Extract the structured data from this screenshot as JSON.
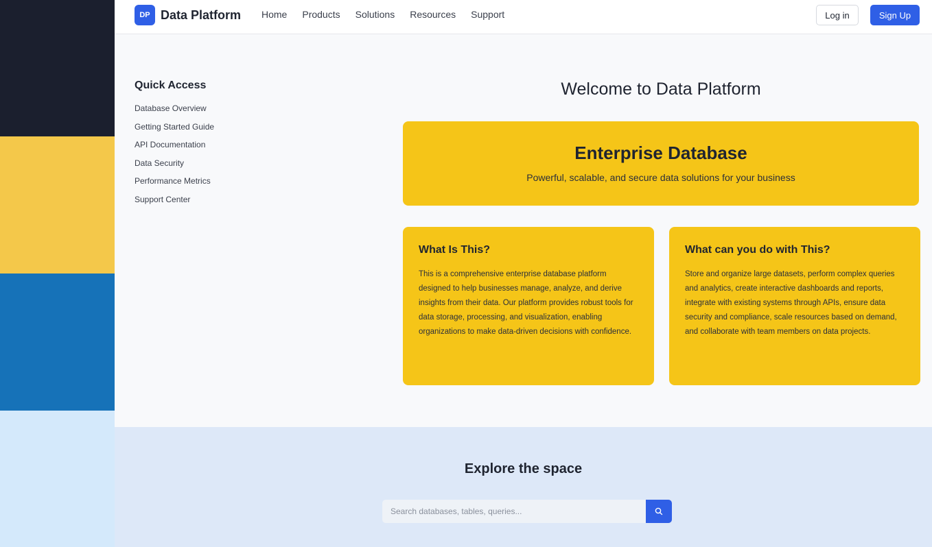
{
  "colors": {
    "strip": [
      "#1b1f2e",
      "#f4c84a",
      "#1672b8",
      "#d4e9fb"
    ],
    "accent": "#2f5fe6",
    "card_yellow": "#f5c518",
    "explore_bg": "#dde8f8"
  },
  "header": {
    "logo_badge": "DP",
    "logo_text": "Data Platform",
    "nav": [
      "Home",
      "Products",
      "Solutions",
      "Resources",
      "Support"
    ],
    "login_label": "Log in",
    "signup_label": "Sign Up"
  },
  "sidebar": {
    "title": "Quick Access",
    "items": [
      "Database Overview",
      "Getting Started Guide",
      "API Documentation",
      "Data Security",
      "Performance Metrics",
      "Support Center"
    ]
  },
  "main": {
    "welcome_title": "Welcome to Data Platform",
    "hero_title": "Enterprise Database",
    "hero_subtitle": "Powerful, scalable, and secure data solutions for your business",
    "cards": [
      {
        "title": "What Is This?",
        "body": "This is a comprehensive enterprise database platform designed to help businesses manage, analyze, and derive insights from their data. Our platform provides robust tools for data storage, processing, and visualization, enabling organizations to make data-driven decisions with confidence."
      },
      {
        "title": "What can you do with This?",
        "body": "Store and organize large datasets, perform complex queries and analytics, create interactive dashboards and reports, integrate with existing systems through APIs, ensure data security and compliance, scale resources based on demand, and collaborate with team members on data projects."
      }
    ]
  },
  "explore": {
    "title": "Explore the space",
    "search_placeholder": "Search databases, tables, queries...",
    "search_icon": "search-icon"
  }
}
